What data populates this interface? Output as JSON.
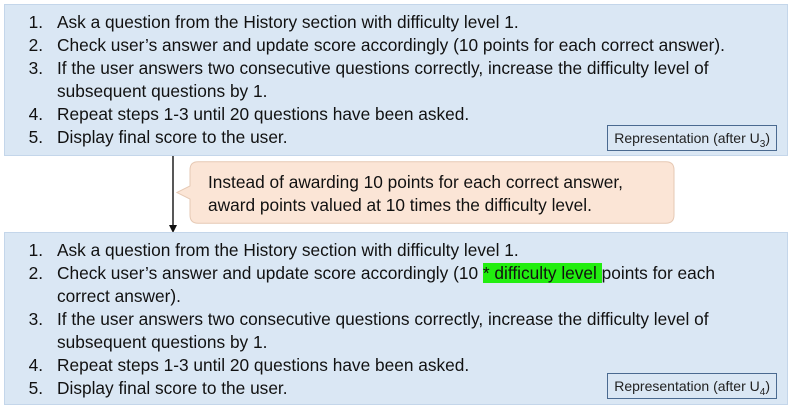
{
  "top_panel": {
    "steps": [
      {
        "num": "1.",
        "text": "Ask a question from the History section with difficulty level 1."
      },
      {
        "num": "2.",
        "text": "Check user’s answer and update score accordingly (10 points for each correct answer)."
      },
      {
        "num": "3.",
        "text": "If the user answers two consecutive questions correctly, increase the difficulty level of subsequent questions by 1."
      },
      {
        "num": "4.",
        "text": "Repeat steps 1-3 until 20 questions have been asked."
      },
      {
        "num": "5.",
        "text": "Display final score to the user."
      }
    ],
    "label": {
      "prefix": "Representation (after U",
      "sub": "3",
      "suffix": ")"
    }
  },
  "callout": {
    "line1": "Instead of awarding 10 points for each correct answer,",
    "line2": "award points valued at 10 times the difficulty level."
  },
  "bottom_panel": {
    "steps": [
      {
        "num": "1.",
        "text": "Ask a question from the History section with difficulty level 1."
      },
      {
        "num": "2.",
        "before": "Check user’s answer and update score accordingly (10 ",
        "highlight": "* difficulty level ",
        "after": "points for each correct answer)."
      },
      {
        "num": "3.",
        "text": "If the user answers two consecutive questions correctly, increase the difficulty level of subsequent questions by 1."
      },
      {
        "num": "4.",
        "text": "Repeat steps 1-3 until 20 questions have been asked."
      },
      {
        "num": "5.",
        "text": "Display final score to the user."
      }
    ],
    "label": {
      "prefix": "Representation (after U",
      "sub": "4",
      "suffix": ")"
    }
  },
  "colors": {
    "panel_bg": "#dae7f4",
    "callout_bg": "#fbe5d6",
    "highlight": "#22ee10"
  }
}
